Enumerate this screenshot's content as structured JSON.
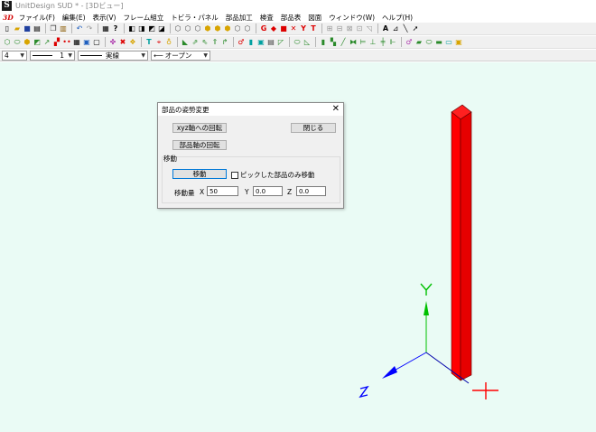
{
  "window": {
    "title": "UnitDesign SUD * - [3Dビュー]"
  },
  "menu": {
    "logo": "3D",
    "items": [
      "ファイル(F)",
      "編集(E)",
      "表示(V)",
      "フレーム組立",
      "トビラ・パネル",
      "部品加工",
      "検査",
      "部品表",
      "図面",
      "ウィンドウ(W)",
      "ヘルプ(H)"
    ]
  },
  "combos": {
    "layer": "4",
    "line_width": "1",
    "line_type": "実線",
    "arrow_type": "オープン"
  },
  "dialog": {
    "title": "部品の姿勢変更",
    "close_label": "✕",
    "rotate_xyz_label": "xyz軸への回転",
    "rotate_part_label": "部品軸の回転",
    "close_button_label": "閉じる",
    "move_group_label": "移動",
    "move_button_label": "移動",
    "picked_only_label": "ピックした部品のみ移動",
    "amount_label": "移動量",
    "x_label": "X",
    "y_label": "Y",
    "z_label": "Z",
    "x_value": "50",
    "y_value": "0.0",
    "z_value": "0.0"
  },
  "axes": {
    "y_color": "#00c000",
    "z_color": "#0000ff",
    "x_color": "#ff0000",
    "part_color": "#ff0000"
  }
}
